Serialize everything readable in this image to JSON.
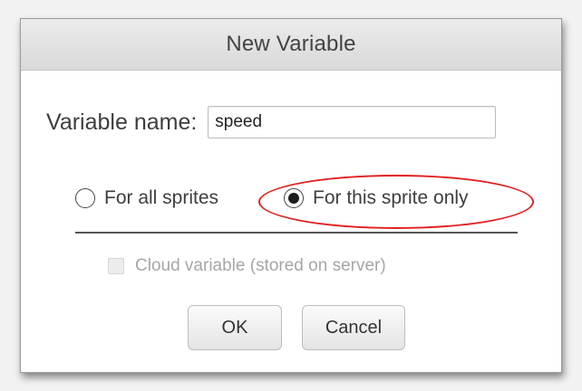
{
  "dialog": {
    "title": "New Variable",
    "name_label": "Variable name:",
    "name_value": "speed",
    "scope_options": [
      {
        "label": "For all sprites",
        "selected": false
      },
      {
        "label": "For this sprite only",
        "selected": true
      }
    ],
    "cloud_checkbox": {
      "label": "Cloud variable (stored on server)",
      "checked": false,
      "disabled": true
    },
    "ok_label": "OK",
    "cancel_label": "Cancel"
  },
  "annotation": {
    "highlight_color": "#e21f1f",
    "highlighted_option": "For this sprite only"
  },
  "icons": {
    "radio_unselected": "radio-unselected-icon",
    "radio_selected": "radio-selected-icon",
    "checkbox": "checkbox-disabled-icon"
  }
}
